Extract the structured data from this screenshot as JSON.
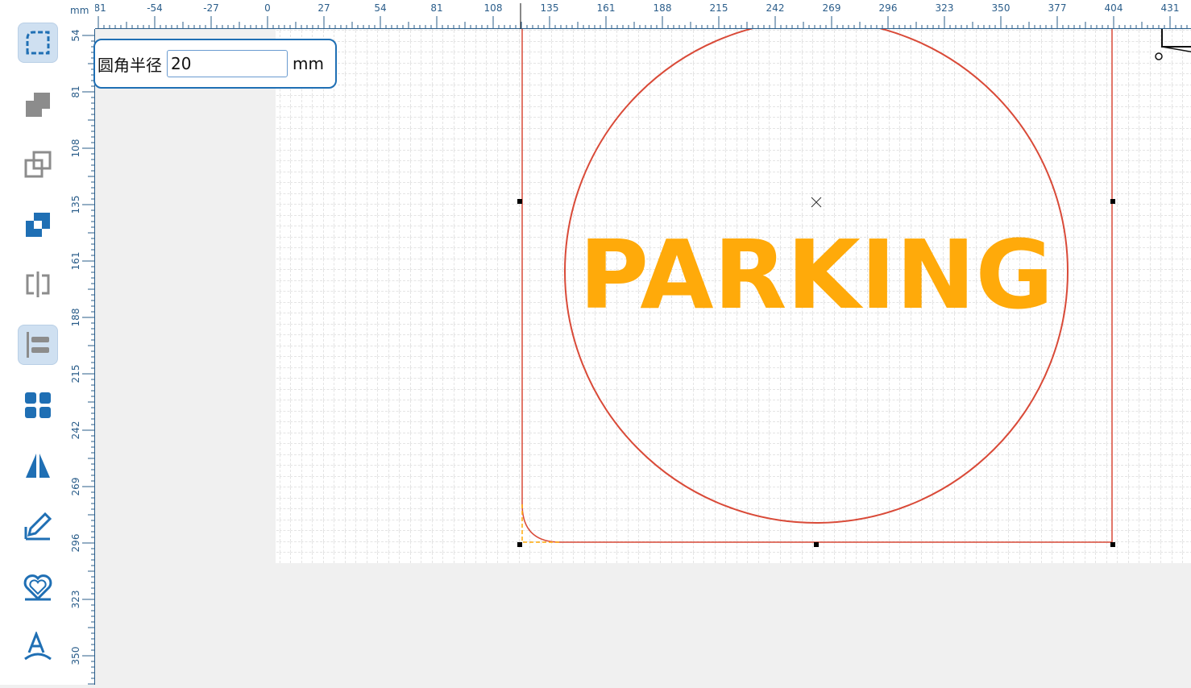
{
  "ruler": {
    "unit": "mm",
    "top_ticks": [
      "-81",
      "-54",
      "-27",
      "0",
      "27",
      "54",
      "81",
      "108",
      "135",
      "161",
      "188",
      "215",
      "242",
      "269",
      "296",
      "323",
      "350",
      "377",
      "404",
      "431"
    ],
    "left_ticks": [
      "54",
      "81",
      "108",
      "135",
      "161",
      "188",
      "215",
      "242",
      "269",
      "296",
      "323",
      "350"
    ]
  },
  "toolbar": {
    "tools": [
      {
        "name": "rounded-corner-tool",
        "icon": "rounded-corner-icon",
        "active": true
      },
      {
        "name": "union-tool",
        "icon": "union-icon",
        "active": false
      },
      {
        "name": "subtract-tool",
        "icon": "subtract-icon",
        "active": false
      },
      {
        "name": "intersect-tool",
        "icon": "intersect-icon",
        "active": false
      },
      {
        "name": "split-tool",
        "icon": "split-icon",
        "active": false
      },
      {
        "name": "align-tool",
        "icon": "align-left-icon",
        "active": true
      },
      {
        "name": "grid-layout-tool",
        "icon": "grid-icon",
        "active": false
      },
      {
        "name": "mirror-tool",
        "icon": "mirror-icon",
        "active": false
      },
      {
        "name": "pen-edit-tool",
        "icon": "pen-icon",
        "active": false
      },
      {
        "name": "outline-tool",
        "icon": "outline-heart-icon",
        "active": false
      },
      {
        "name": "text-path-tool",
        "icon": "text-path-icon",
        "active": false
      }
    ]
  },
  "radius_panel": {
    "label": "圆角半径",
    "value": "20",
    "unit": "mm"
  },
  "canvas": {
    "text": "PARKING",
    "text_color": "#FFAA0A",
    "shape_color": "#D94A38",
    "accent_color": "#1F6FB4"
  }
}
